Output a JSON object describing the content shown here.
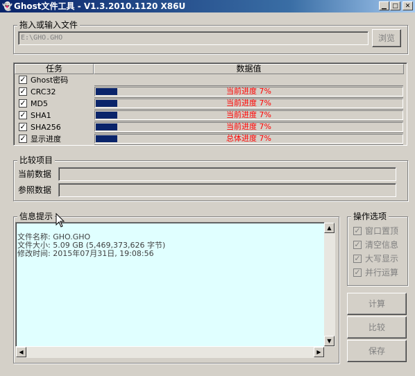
{
  "window": {
    "title": "Ghost文件工具 - V1.3.2010.1120 X86U"
  },
  "file_group": {
    "title": "拖入或输入文件",
    "path": "E:\\GHO.GHO",
    "browse_label": "浏览"
  },
  "tasks": {
    "header_task": "任务",
    "header_value": "数据值",
    "rows": [
      {
        "label": "Ghost密码",
        "checked": true,
        "progress_text": "",
        "progress": null
      },
      {
        "label": "CRC32",
        "checked": true,
        "progress_text": "当前进度 7%",
        "progress": 0.07
      },
      {
        "label": "MD5",
        "checked": true,
        "progress_text": "当前进度 7%",
        "progress": 0.07
      },
      {
        "label": "SHA1",
        "checked": true,
        "progress_text": "当前进度 7%",
        "progress": 0.07
      },
      {
        "label": "SHA256",
        "checked": true,
        "progress_text": "当前进度 7%",
        "progress": 0.07
      },
      {
        "label": "显示进度",
        "checked": true,
        "progress_text": "总体进度 7%",
        "progress": 0.07
      }
    ]
  },
  "compare": {
    "title": "比较项目",
    "current_label": "当前数据",
    "reference_label": "参照数据"
  },
  "info": {
    "title": "信息提示",
    "lines": [
      "文件名称: GHO.GHO",
      "文件大小: 5.09 GB (5,469,373,626 字节)",
      "修改时间: 2015年07月31日, 19:08:56"
    ]
  },
  "options": {
    "title": "操作选项",
    "items": [
      {
        "label": "窗口置顶",
        "checked": true
      },
      {
        "label": "清空信息",
        "checked": true
      },
      {
        "label": "大写显示",
        "checked": true
      },
      {
        "label": "并行运算",
        "checked": true
      }
    ]
  },
  "actions": {
    "compute_label": "计算",
    "compare_label": "比较",
    "save_label": "保存"
  },
  "colors": {
    "title_bar": "#0a246a",
    "progress_fill": "#0a246a",
    "progress_text": "#ff0000",
    "info_bg": "#e0ffff"
  }
}
